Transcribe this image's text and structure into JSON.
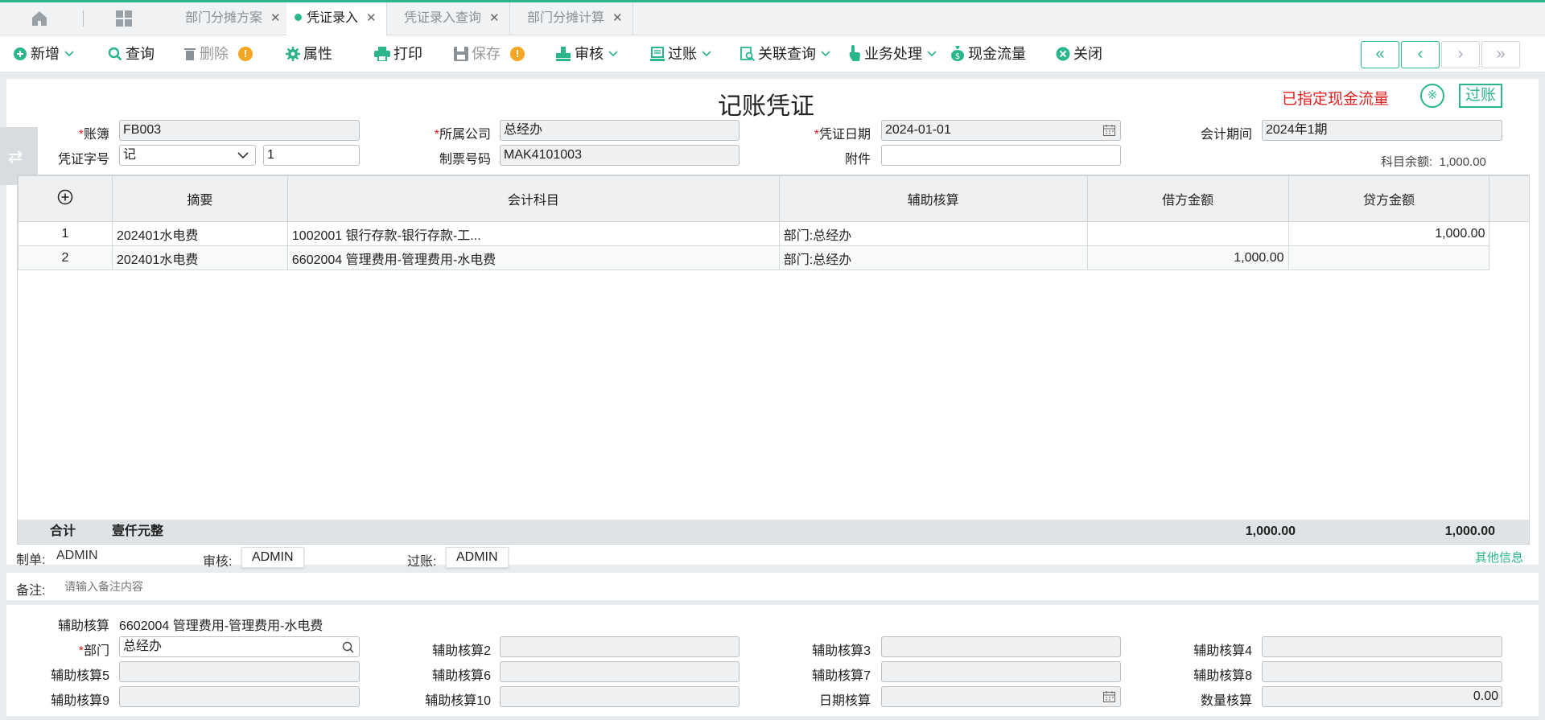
{
  "tabs": {
    "items": [
      {
        "label": "部门分摊方案",
        "active": false
      },
      {
        "label": "凭证录入",
        "active": true
      },
      {
        "label": "凭证录入查询",
        "active": false
      },
      {
        "label": "部门分摊计算",
        "active": false
      }
    ]
  },
  "toolbar": {
    "add": "新增",
    "query": "查询",
    "delete": "删除",
    "properties": "属性",
    "print": "打印",
    "save": "保存",
    "audit": "审核",
    "post": "过账",
    "related_query": "关联查询",
    "business": "业务处理",
    "cash_flow": "现金流量",
    "close": "关闭"
  },
  "voucher": {
    "title": "记账凭证",
    "cash_flow_status": "已指定现金流量",
    "posted_badge": "过账",
    "ledger_label": "账簿",
    "ledger": "FB003",
    "company_label": "所属公司",
    "company": "总经办",
    "date_label": "凭证日期",
    "date": "2024-01-01",
    "period_label": "会计期间",
    "period": "2024年1期",
    "word_label": "凭证字号",
    "word": "记",
    "number": "1",
    "ticket_label": "制票号码",
    "ticket": "MAK4101003",
    "attach_label": "附件",
    "attach": "",
    "balance_label": "科目余额:",
    "balance": "1,000.00"
  },
  "grid": {
    "headers": {
      "summary": "摘要",
      "account": "会计科目",
      "aux": "辅助核算",
      "debit": "借方金额",
      "credit": "贷方金额"
    },
    "rows": [
      {
        "no": "1",
        "summary": "202401水电费",
        "account": "1002001 银行存款-银行存款-工...",
        "aux": "部门:总经办",
        "debit": "",
        "credit": "1,000.00"
      },
      {
        "no": "2",
        "summary": "202401水电费",
        "account": "6602004 管理费用-管理费用-水电费",
        "aux": "部门:总经办",
        "debit": "1,000.00",
        "credit": ""
      }
    ],
    "total_label": "合计",
    "total_words": "壹仟元整",
    "total_debit": "1,000.00",
    "total_credit": "1,000.00"
  },
  "footer": {
    "maker_label": "制单:",
    "maker": "ADMIN",
    "auditor_label": "审核:",
    "auditor": "ADMIN",
    "poster_label": "过账:",
    "poster": "ADMIN",
    "other_info": "其他信息",
    "remark_label": "备注:",
    "remark_placeholder": "请输入备注内容"
  },
  "aux": {
    "title_label": "辅助核算",
    "title_value": "6602004 管理费用-管理费用-水电费",
    "dept_label": "部门",
    "dept": "总经办",
    "a2": "辅助核算2",
    "a3": "辅助核算3",
    "a4": "辅助核算4",
    "a5": "辅助核算5",
    "a6": "辅助核算6",
    "a7": "辅助核算7",
    "a8": "辅助核算8",
    "a9": "辅助核算9",
    "a10": "辅助核算10",
    "date_label": "日期核算",
    "qty_label": "数量核算",
    "qty": "0.00"
  },
  "colors": {
    "accent": "#2bb58d",
    "required": "#e02020",
    "warning": "#f5a623"
  }
}
